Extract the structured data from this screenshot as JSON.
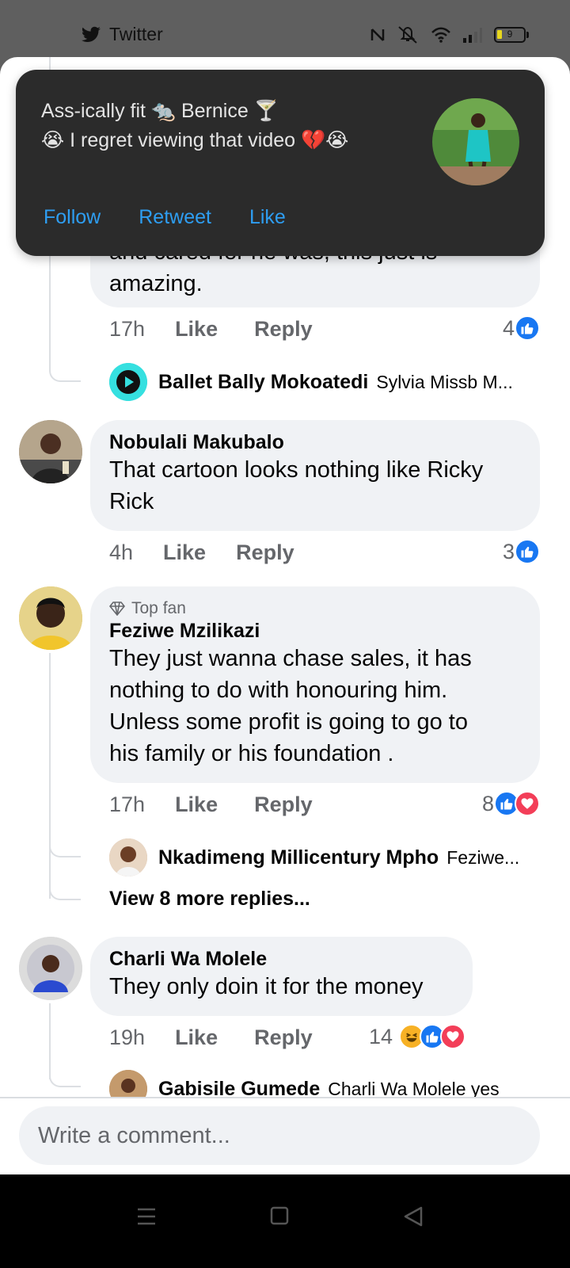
{
  "status_bar": {
    "app_name": "Twitter",
    "battery": "9"
  },
  "toast": {
    "title": "Ass-ically fit 🐀 Bernice 🍸",
    "message": "😭 I regret viewing that video 💔😭",
    "actions": [
      "Follow",
      "Retweet",
      "Like"
    ]
  },
  "partial_comment": {
    "text_cut": "and cared for he was, this just is",
    "text": "amazing.",
    "time": "17h",
    "like": "Like",
    "reply": "Reply",
    "reactions": "4",
    "reply_preview": {
      "name": "Ballet Bally Mokoatedi",
      "preview": "Sylvia Missb M..."
    }
  },
  "comments": [
    {
      "author": "Nobulali Makubalo",
      "text_lines": [
        "That cartoon looks nothing like Ricky",
        "Rick"
      ],
      "time": "4h",
      "like": "Like",
      "reply": "Reply",
      "reactions": "3"
    },
    {
      "badge": "Top fan",
      "author": "Feziwe Mzilikazi",
      "text_lines": [
        "They just wanna chase sales, it has",
        "nothing to do with honouring him.",
        "Unless some profit is going to go to",
        "his family or his  foundation ."
      ],
      "time": "17h",
      "like": "Like",
      "reply": "Reply",
      "reactions": "8",
      "reply_preview": {
        "name": "Nkadimeng Millicentury Mpho",
        "preview": "Feziwe..."
      },
      "more_replies": "View 8 more replies..."
    },
    {
      "author": "Charli Wa Molele",
      "text": "They only doin it for the money",
      "time": "19h",
      "like": "Like",
      "reply": "Reply",
      "reactions": "14",
      "reply_preview": {
        "name": "Gabisile Gumede",
        "preview": "Charli Wa Molele yes"
      }
    }
  ],
  "composer": {
    "placeholder": "Write a comment..."
  }
}
